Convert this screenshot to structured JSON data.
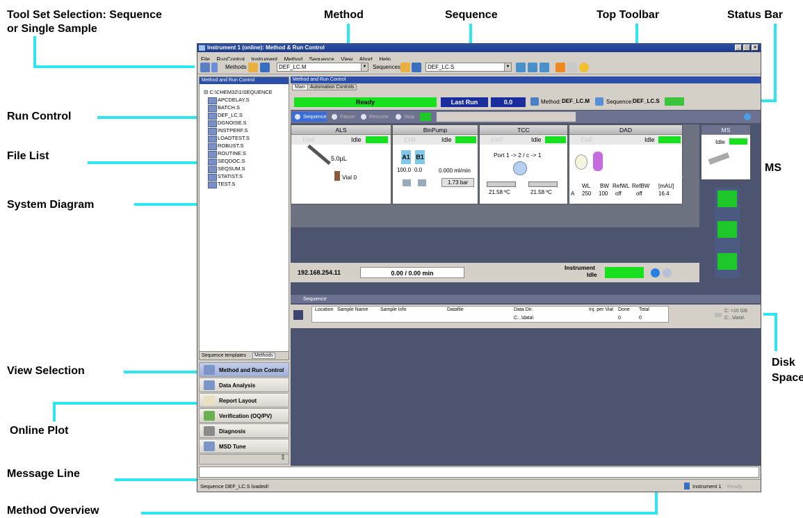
{
  "annotations": {
    "tool_set": [
      "Tool Set Selection: Sequence",
      "or Single Sample"
    ],
    "method": "Method",
    "sequence": "Sequence",
    "top_toolbar": "Top Toolbar",
    "status_bar": "Status Bar",
    "run_control": "Run Control",
    "file_list": "File List",
    "system_diagram": "System Diagram",
    "ms": "MS",
    "view_selection": "View Selection",
    "disk_space": [
      "Disk",
      "Space"
    ],
    "online_plot": "Online Plot",
    "message_line": "Message Line",
    "method_overview": "Method Overview"
  },
  "window": {
    "title": "Instrument 1 (online): Method & Run Control",
    "menu": [
      "File",
      "RunControl",
      "Instrument",
      "Method",
      "Sequence",
      "View",
      "Abort",
      "Help"
    ],
    "toolbar": {
      "methods_label": "Methods",
      "method_value": "DEF_LC.M",
      "sequences_label": "Sequences",
      "sequence_value": "DEF_LC.S"
    },
    "colors": {
      "accent": "#2fe6f0",
      "title_bar": "#2b4fa8",
      "ready_green": "#19e01e",
      "last_run_blue": "#1b2c9c"
    }
  },
  "left_panel": {
    "header": "Method and Run Control",
    "root": "C:\\CHEM32\\1\\SEQUENCE",
    "files": [
      "APCDELAY.S",
      "BATCH.S",
      "DEF_LC.S",
      "DGNOISE.S",
      "INSTPERF.S",
      "LOADTEST.S",
      "ROBUST.S",
      "ROUTINE.S",
      "SEQDOC.S",
      "SEQSUM.S",
      "STATIST.S",
      "TEST.S"
    ],
    "tabs": [
      "Sequence templates",
      "Methods"
    ],
    "views": [
      "Method and Run Control",
      "Data Analysis",
      "Report Layout",
      "Verification (OQ/PV)",
      "Diagnosis",
      "MSD Tune"
    ]
  },
  "main": {
    "header": "Method and Run Control",
    "tabs": [
      "Main",
      "Automation Controls"
    ],
    "status": {
      "ready": "Ready",
      "last_run": "Last Run",
      "last_run_value": "0.0",
      "method_label": "Method:",
      "method_value": "DEF_LC.M",
      "sequence_label": "Sequence:",
      "sequence_value": "DEF_LC.S"
    },
    "run_control": [
      "Sequence",
      "Pause",
      "Resume",
      "Stop"
    ],
    "modules": {
      "als": {
        "name": "ALS",
        "emf": "EMF",
        "state": "Idle",
        "volume": "5.0µL",
        "vial": "Vial 0"
      },
      "pump": {
        "name": "BinPump",
        "emf": "EMF",
        "state": "Idle",
        "a1": "A1",
        "b1": "B1",
        "a_pct": "100.0",
        "b_pct": "0.0",
        "flow": "0.000 ml/min",
        "pressure": "1.73 bar"
      },
      "tcc": {
        "name": "TCC",
        "emf": "EMF",
        "state": "Idle",
        "port": "Port 1 -> 2 / c -> 1",
        "temp_left": "21.58 ºC",
        "temp_right": "21.58 ºC"
      },
      "dad": {
        "name": "DAD",
        "emf": "EMF",
        "state": "Idle",
        "headers": [
          "WL",
          "BW",
          "RefWL",
          "RefBW",
          "[mAU]"
        ],
        "row": [
          "A",
          "250",
          "100",
          "off",
          "off",
          "16.4"
        ]
      },
      "ms": {
        "name": "MS",
        "state": "Idle"
      }
    },
    "data_analysis_label": "Data Analysis",
    "ip": "192.168.254.11",
    "runtime": "0.00 /  0.00 min",
    "instrument_label": "Instrument",
    "instrument_state": "Idle",
    "sequence_header": "Sequence",
    "seq_columns": [
      "Location",
      "Sample Name",
      "Sample Info",
      "Datafile",
      "Data Dir.",
      "Inj. per Vial",
      "Done",
      "Total"
    ],
    "seq_row": {
      "data_dir": "C:..\\data\\",
      "done": "0",
      "total": "0"
    },
    "disk": [
      "C: >10 GB",
      "C:..\\data\\"
    ]
  },
  "status_bar": {
    "message": "Sequence DEF_LC.S loaded!",
    "instrument": "Instrument 1",
    "state": "Ready"
  }
}
